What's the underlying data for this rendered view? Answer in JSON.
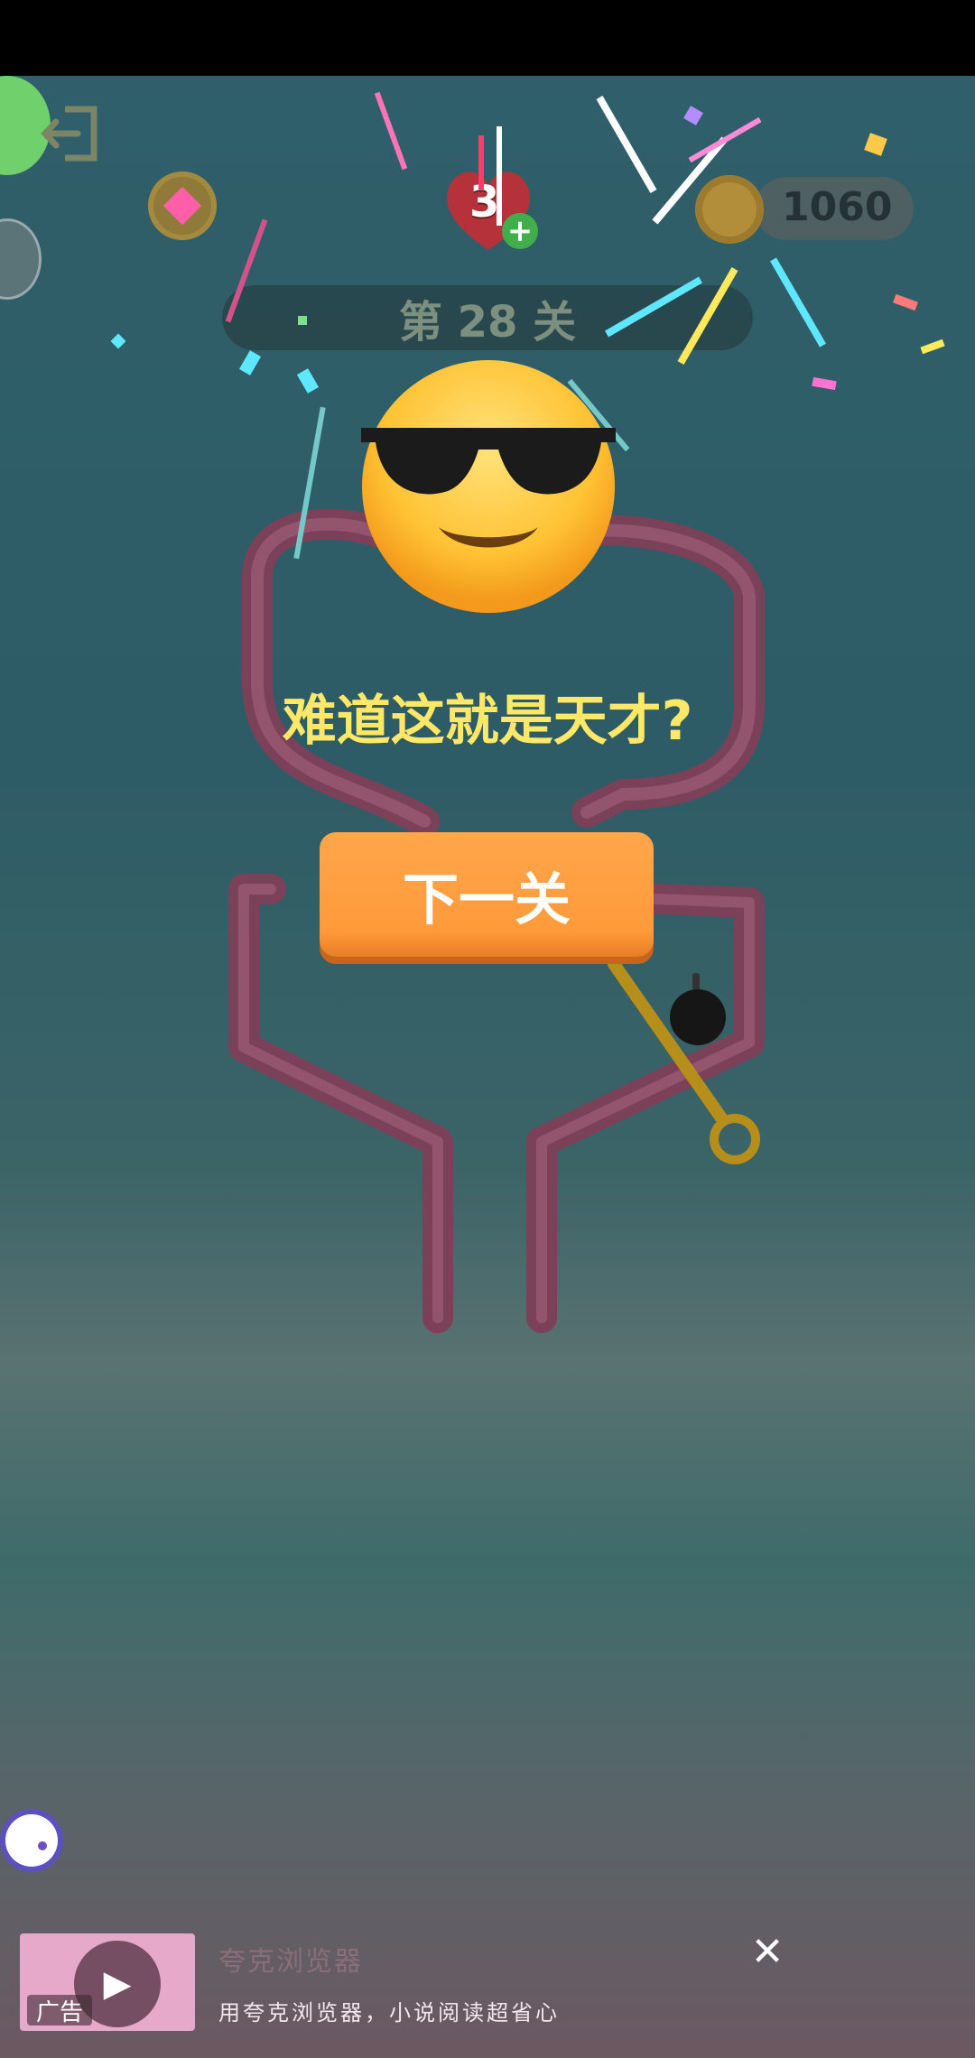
{
  "hud": {
    "exit_icon": "exit-icon",
    "gem_icon": "gem-icon",
    "lives": "3",
    "lives_plus": "+",
    "coins": "1060",
    "level_title": "第 28 关"
  },
  "result": {
    "emoji": "sunglasses-face",
    "message": "难道这就是天才?",
    "next_button": "下一关"
  },
  "ad": {
    "tag": "广告",
    "title": "夸克浏览器",
    "description": "用夸克浏览器，小说阅读超省心",
    "close": "✕"
  },
  "colors": {
    "accent_button": "#ff9f44",
    "message_text": "#ffe867",
    "pipe": "#8a4a62",
    "pin": "#b68f1a"
  }
}
